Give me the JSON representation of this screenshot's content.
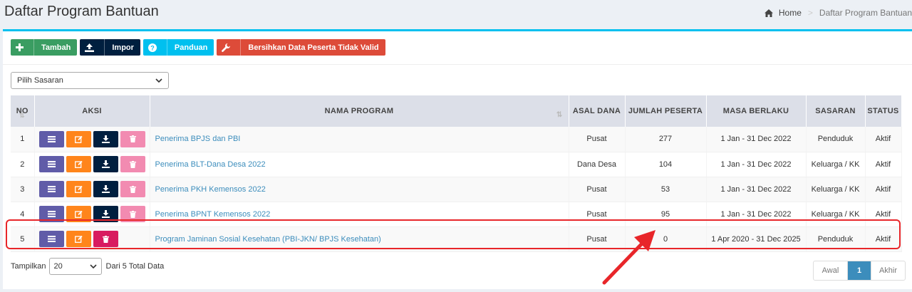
{
  "header": {
    "title": "Daftar Program Bantuan",
    "breadcrumb": {
      "home": "Home",
      "current": "Daftar Program Bantuan"
    }
  },
  "toolbar": {
    "tambah": "Tambah",
    "impor": "Impor",
    "panduan": "Panduan",
    "bersihkan": "Bersihkan Data Peserta Tidak Valid"
  },
  "filter": {
    "sasaran_selected": "Pilih Sasaran"
  },
  "table": {
    "columns": [
      "NO",
      "AKSI",
      "NAMA PROGRAM",
      "ASAL DANA",
      "JUMLAH PESERTA",
      "MASA BERLAKU",
      "SASARAN",
      "STATUS"
    ],
    "rows": [
      {
        "no": "1",
        "nama": "Penerima BPJS dan PBI",
        "asal_dana": "Pusat",
        "jumlah": "277",
        "masa": "1 Jan - 31 Dec 2022",
        "sasaran": "Penduduk",
        "status": "Aktif"
      },
      {
        "no": "2",
        "nama": "Penerima BLT-Dana Desa 2022",
        "asal_dana": "Dana Desa",
        "jumlah": "104",
        "masa": "1 Jan - 31 Dec 2022",
        "sasaran": "Keluarga / KK",
        "status": "Aktif"
      },
      {
        "no": "3",
        "nama": "Penerima PKH Kemensos 2022",
        "asal_dana": "Pusat",
        "jumlah": "53",
        "masa": "1 Jan - 31 Dec 2022",
        "sasaran": "Keluarga / KK",
        "status": "Aktif"
      },
      {
        "no": "4",
        "nama": "Penerima BPNT Kemensos 2022",
        "asal_dana": "Pusat",
        "jumlah": "95",
        "masa": "1 Jan - 31 Dec 2022",
        "sasaran": "Keluarga / KK",
        "status": "Aktif"
      },
      {
        "no": "5",
        "nama": "Program Jaminan Sosial Kesehatan (PBI-JKN/ BPJS Kesehatan)",
        "asal_dana": "Pusat",
        "jumlah": "0",
        "masa": "1 Apr 2020 - 31 Dec 2025",
        "sasaran": "Penduduk",
        "status": "Aktif"
      }
    ]
  },
  "footer": {
    "tampilkan": "Tampilkan",
    "page_size": "20",
    "total_text": "Dari 5 Total Data"
  },
  "pagination": {
    "first": "Awal",
    "current": "1",
    "last": "Akhir"
  },
  "colors": {
    "accent": "#00c0ef",
    "link": "#3c8dbc",
    "highlight": "#e8262a"
  }
}
